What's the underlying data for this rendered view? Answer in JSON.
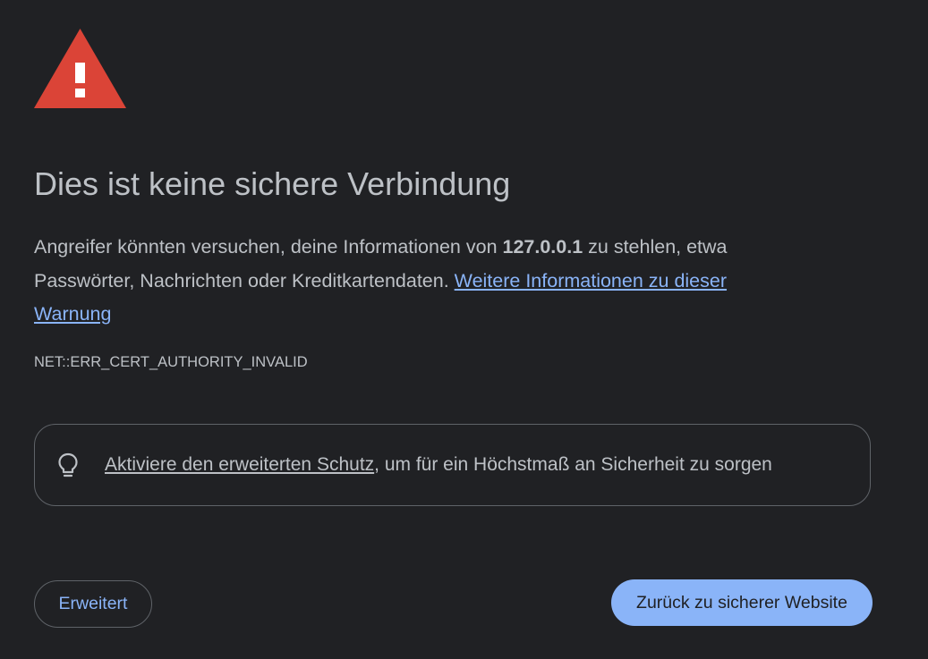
{
  "title": "Dies ist keine sichere Verbindung",
  "description": {
    "part1": "Angreifer könnten versuchen, deine Informationen von ",
    "host": "127.0.0.1",
    "part2": " zu stehlen, etwa Passwörter, Nachrichten oder Kreditkartendaten. ",
    "learn_more_link": "Weitere Informationen zu dieser Warnung"
  },
  "error_code": "NET::ERR_CERT_AUTHORITY_INVALID",
  "enhanced_protection": {
    "icon": "lightbulb-icon",
    "link": "Aktiviere den erweiterten Schutz",
    "text": ", um für ein Höchstmaß an Sicherheit zu sorgen"
  },
  "buttons": {
    "advanced": "Erweitert",
    "back_to_safety": "Zurück zu sicherer Website"
  },
  "colors": {
    "background": "#202124",
    "text": "#bdc1c6",
    "link": "#8ab4f8",
    "warning": "#db4437",
    "primary_button": "#8ab4f8"
  }
}
